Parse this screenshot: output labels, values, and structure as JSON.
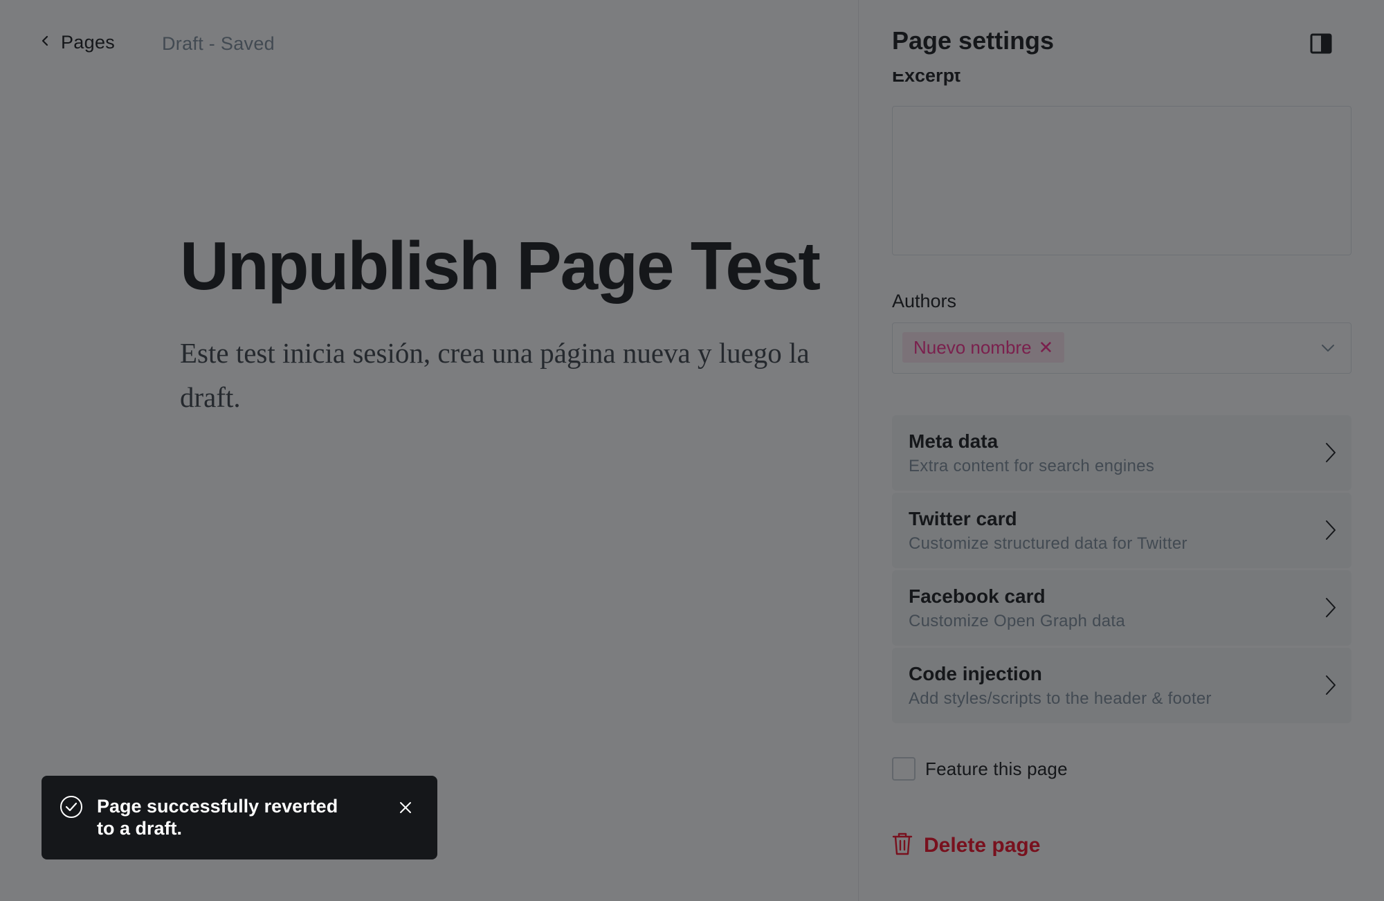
{
  "topbar": {
    "back_label": "Pages",
    "status": "Draft - Saved"
  },
  "editor": {
    "title": "Unpublish Page Test",
    "excerpt_text": "Este test inicia sesión, crea una página nueva y luego la draft."
  },
  "settings_panel": {
    "title": "Page settings",
    "excerpt_label": "Excerpt",
    "excerpt_value": "",
    "authors_label": "Authors",
    "authors": [
      {
        "name": "Nuevo nombre"
      }
    ],
    "nav_items": [
      {
        "title": "Meta data",
        "description": "Extra content for search engines"
      },
      {
        "title": "Twitter card",
        "description": "Customize structured data for Twitter"
      },
      {
        "title": "Facebook card",
        "description": "Customize Open Graph data"
      },
      {
        "title": "Code injection",
        "description": "Add styles/scripts to the header & footer"
      }
    ],
    "feature_label": "Feature this page",
    "feature_checked": false,
    "delete_label": "Delete page"
  },
  "toast": {
    "message": "Page successfully reverted to a draft."
  },
  "colors": {
    "accent_pink": "#fb2d8d",
    "danger_red": "#f50b23",
    "toast_bg": "#15171a"
  }
}
